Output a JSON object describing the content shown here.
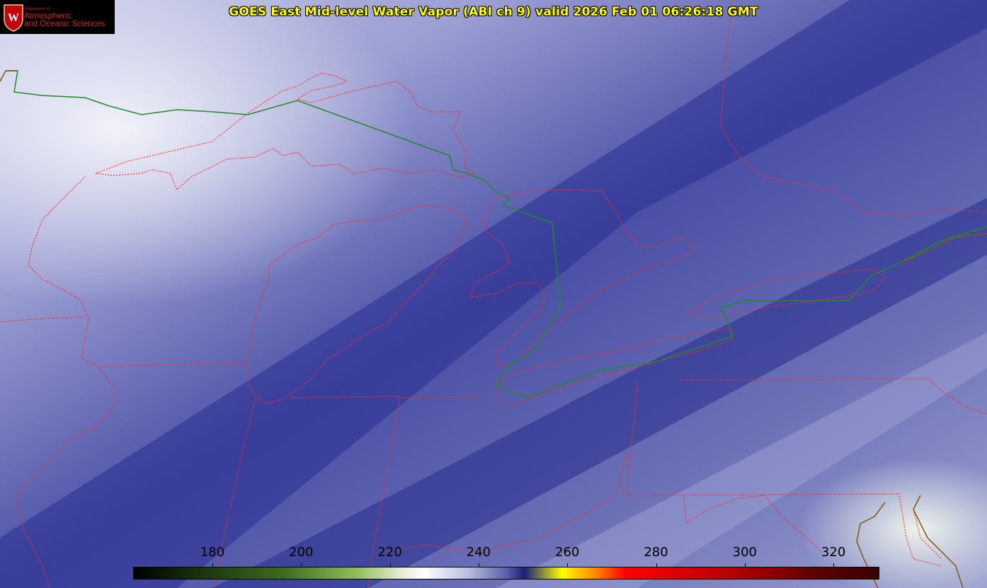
{
  "title": "GOES East Mid-level Water Vapor (ABI ch 9)  valid 2026 Feb 01 06:26:18 GMT",
  "logo": {
    "dept": "Department of",
    "line1": "Atmospheric",
    "line2": "and Oceanic Sciences"
  },
  "colorbar": {
    "ticks": [
      "180",
      "200",
      "220",
      "240",
      "260",
      "280",
      "300",
      "320"
    ],
    "colors": [
      "#000000",
      "#1d3a10",
      "#3d6b1e",
      "#8fbf5a",
      "#e8ecd8",
      "#ffffff",
      "#b8bde0",
      "#5a5fa8",
      "#1a1f7a",
      "#ffff00",
      "#ff8800",
      "#ff0000",
      "#b80000",
      "#5a0000",
      "#3a0000"
    ]
  },
  "colors": {
    "title_text": "#ffff00",
    "state_border": "#ff2a2a",
    "intl_border": "#1f8a2a",
    "coast": "#7a5a10"
  }
}
